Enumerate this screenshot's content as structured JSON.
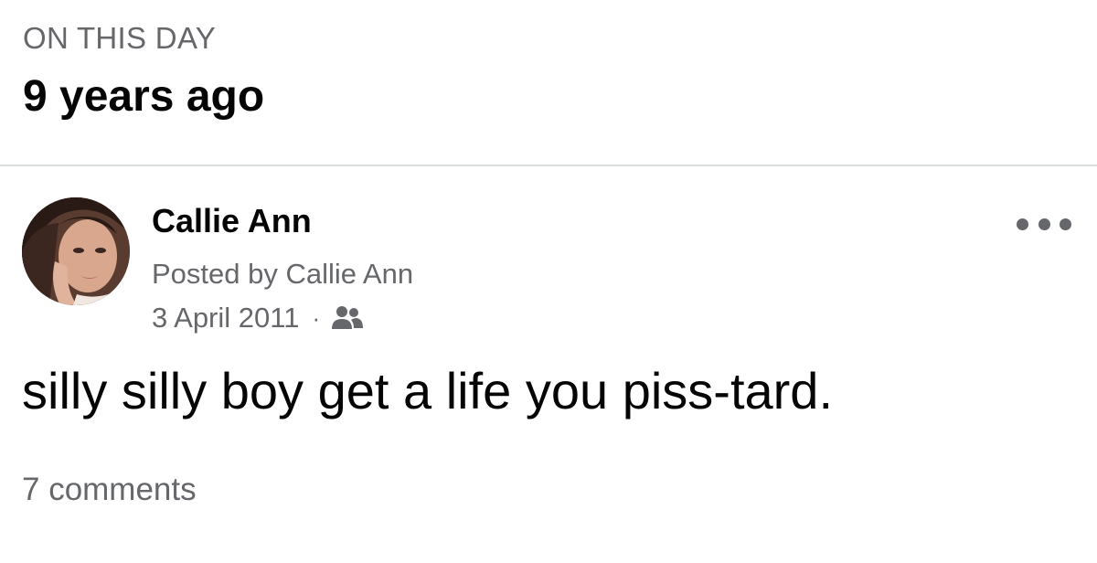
{
  "memory_header": {
    "eyebrow": "ON THIS DAY",
    "title": "9 years ago"
  },
  "post": {
    "author_name": "Callie Ann",
    "posted_by": "Posted by Callie Ann",
    "date": "3 April 2011",
    "separator": "·",
    "audience_icon": "friends-icon",
    "more_icon": "more-options-icon",
    "text": "silly silly boy get a life you piss-tard.",
    "comments": "7 comments"
  },
  "colors": {
    "primary_text": "#050505",
    "secondary_text": "#65676b",
    "divider": "#dadde1"
  }
}
